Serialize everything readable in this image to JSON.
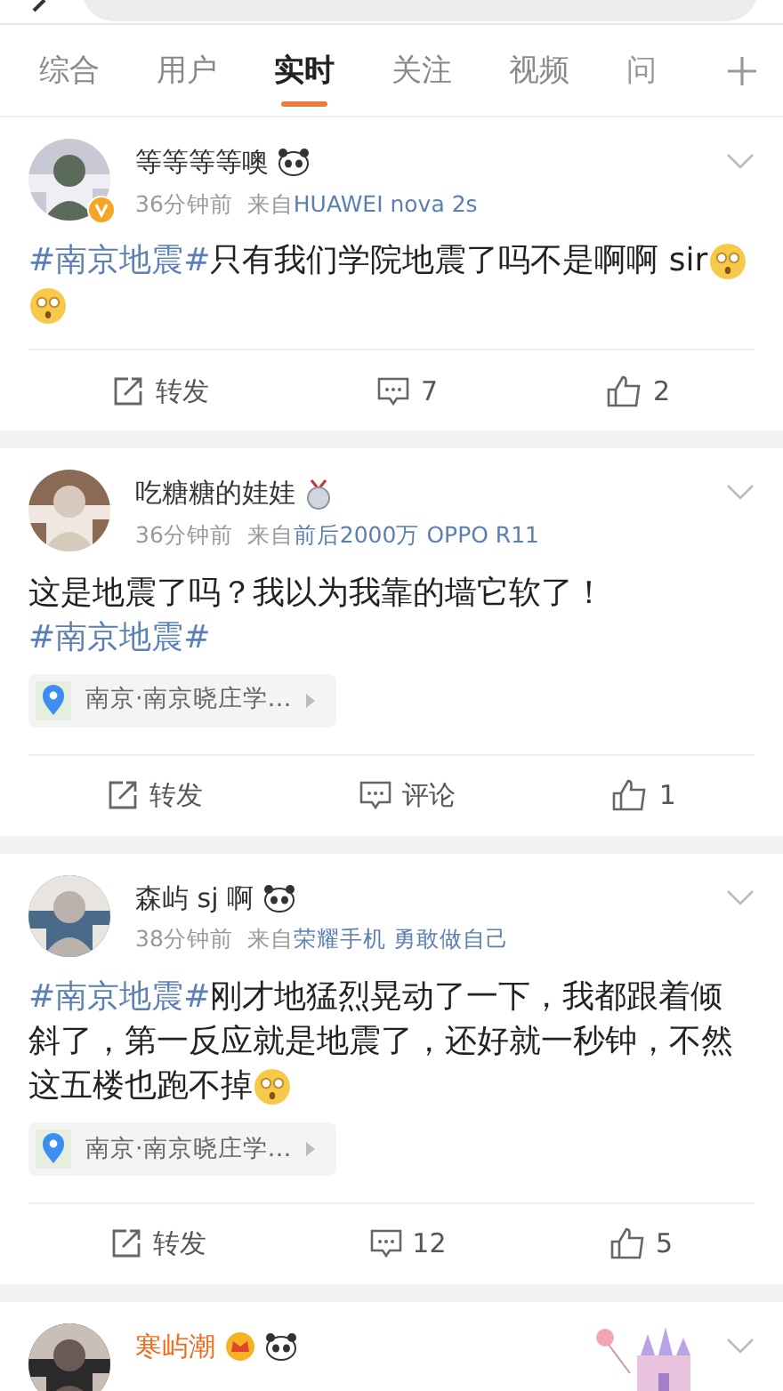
{
  "tabs": [
    {
      "label": "综合",
      "selected": false
    },
    {
      "label": "用户",
      "selected": false
    },
    {
      "label": "实时",
      "selected": true
    },
    {
      "label": "关注",
      "selected": false
    },
    {
      "label": "视频",
      "selected": false
    },
    {
      "label": "问",
      "selected": false
    }
  ],
  "posts": [
    {
      "user": "等等等等噢",
      "vip": false,
      "verified": true,
      "badges": [
        {
          "kind": "panda"
        }
      ],
      "time": "36分钟前",
      "from": "来自",
      "source": "HUAWEI nova 2s",
      "content": [
        {
          "kind": "topic",
          "text": "#南京地震#"
        },
        {
          "kind": "plain",
          "text": "只有我们学院地震了吗不是啊啊 sir"
        },
        {
          "kind": "emoji"
        },
        {
          "kind": "emoji"
        }
      ],
      "repost": "转发",
      "comment": "7",
      "like": "2"
    },
    {
      "user": "吃糖糖的娃娃",
      "vip": false,
      "verified": false,
      "badges": [
        {
          "kind": "medal"
        }
      ],
      "time": "36分钟前",
      "from": "来自",
      "source": "前后2000万 OPPO R11",
      "content": [
        {
          "kind": "plain",
          "text": "这是地震了吗？我以为我靠的墙它软了！"
        },
        {
          "kind": "topic",
          "text": "#南京地震#"
        }
      ],
      "location": "南京·南京晓庄学…",
      "repost": "转发",
      "comment": "评论",
      "like": "1"
    },
    {
      "user": "森屿 sj 啊",
      "vip": false,
      "verified": false,
      "badges": [
        {
          "kind": "panda"
        }
      ],
      "time": "38分钟前",
      "from": "来自",
      "source": "荣耀手机 勇敢做自己",
      "content": [
        {
          "kind": "topic",
          "text": "#南京地震#"
        },
        {
          "kind": "plain",
          "text": "刚才地猛烈晃动了一下，我都跟着倾斜了，第一反应就是地震了，还好就一秒钟，不然这五楼也跑不掉"
        },
        {
          "kind": "emoji"
        }
      ],
      "location": "南京·南京晓庄学…",
      "repost": "转发",
      "comment": "12",
      "like": "5"
    },
    {
      "user": "寒屿潮",
      "vip": true,
      "verified": false,
      "badges": [
        {
          "kind": "crown"
        },
        {
          "kind": "panda"
        }
      ]
    }
  ]
}
